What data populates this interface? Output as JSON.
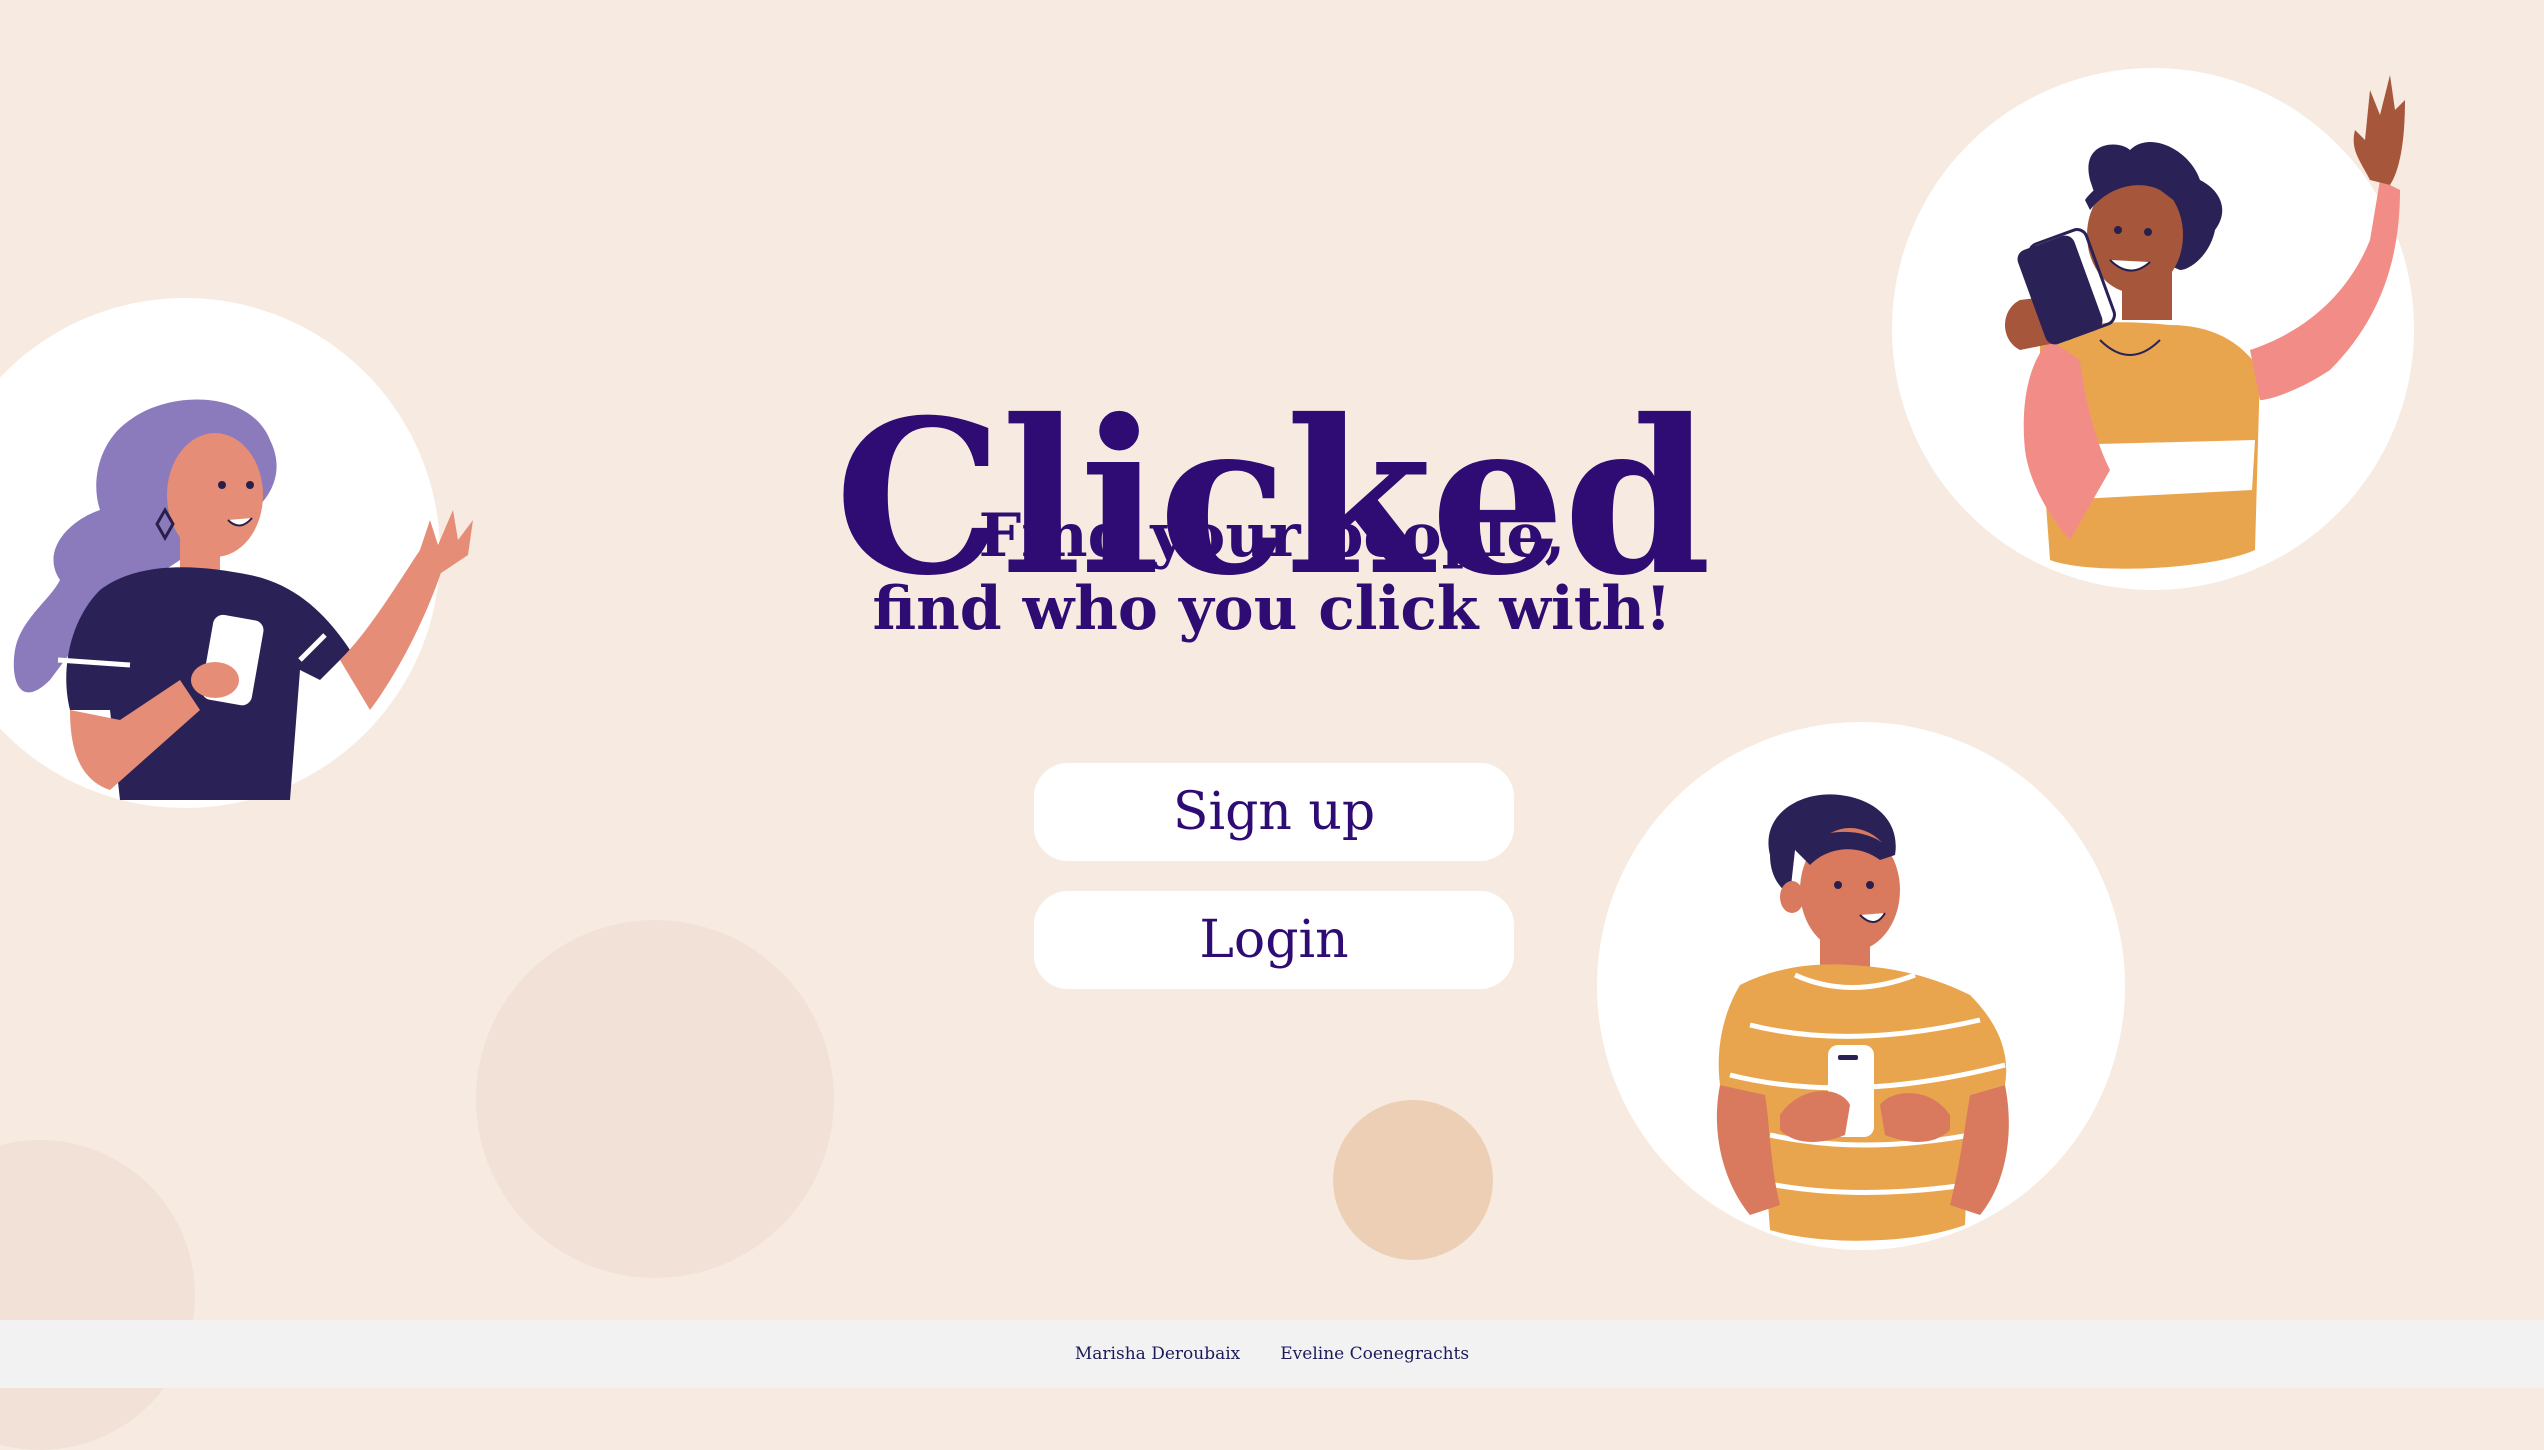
{
  "hero": {
    "title": "Clicked",
    "tagline_line1": "Find your people,",
    "tagline_line2": "find who you click with!"
  },
  "actions": {
    "signup_label": "Sign up",
    "login_label": "Login"
  },
  "footer": {
    "credits": [
      "Marisha Deroubaix",
      "Eveline Coenegrachts"
    ]
  },
  "colors": {
    "background": "#f7ebe1",
    "brand": "#2f0c73",
    "button_bg": "#ffffff",
    "footer_bg": "#f2f2f2"
  },
  "illustrations": [
    "woman-with-phone-icon",
    "man-waving-with-phone-icon",
    "man-holding-phone-icon"
  ]
}
